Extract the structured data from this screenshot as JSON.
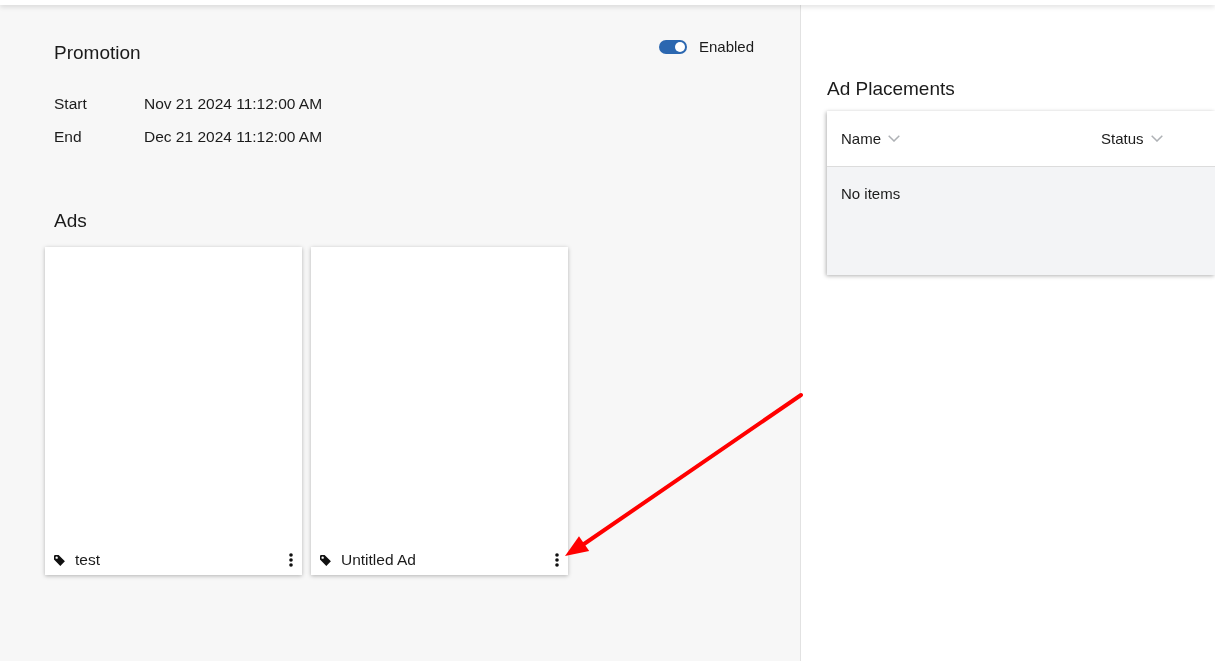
{
  "promotion": {
    "title": "Promotion",
    "enabled_toggle": {
      "label": "Enabled",
      "on": true
    },
    "dates": [
      {
        "label": "Start",
        "value": "Nov 21 2024 11:12:00 AM"
      },
      {
        "label": "End",
        "value": "Dec 21 2024 11:12:00 AM"
      }
    ]
  },
  "ads": {
    "title": "Ads",
    "cards": [
      {
        "name": "test"
      },
      {
        "name": "Untitled Ad"
      }
    ]
  },
  "ad_placements": {
    "title": "Ad Placements",
    "columns": [
      {
        "label": "Name"
      },
      {
        "label": "Status"
      }
    ],
    "empty_text": "No items"
  },
  "annotations": [
    {
      "kind": "arrow"
    }
  ]
}
